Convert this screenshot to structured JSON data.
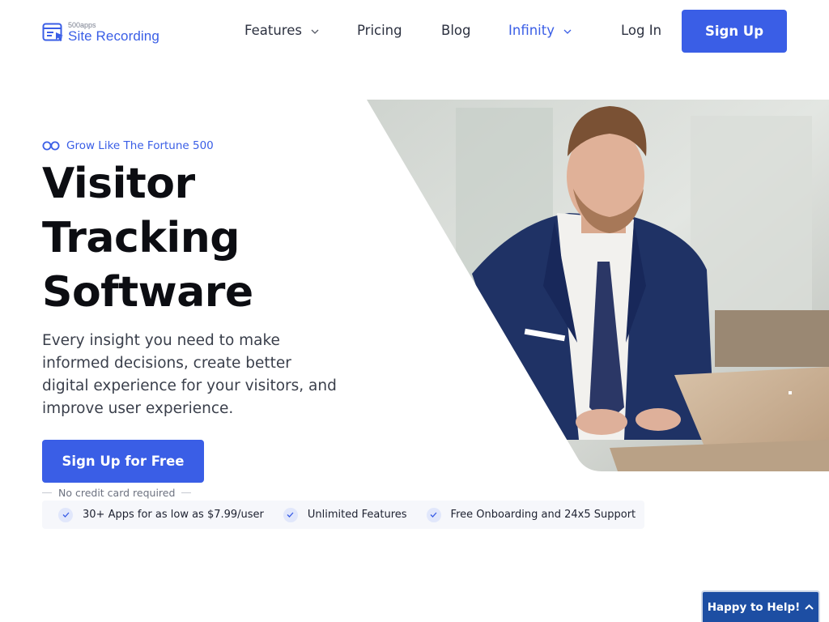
{
  "header": {
    "logo_small": "500apps",
    "logo_main": "Site Recording",
    "nav": [
      {
        "label": "Features",
        "dropdown": true
      },
      {
        "label": "Pricing",
        "dropdown": false
      },
      {
        "label": "Blog",
        "dropdown": false
      },
      {
        "label": "Infinity",
        "dropdown": true
      }
    ],
    "login_label": "Log In",
    "signup_label": "Sign Up"
  },
  "hero": {
    "eyebrow": "Grow Like The Fortune 500",
    "title_lines": [
      "Visitor",
      "Tracking",
      "Software"
    ],
    "description": "Every insight you need to make informed decisions, create better digital experience for your visitors, and improve user experience.",
    "cta_label": "Sign Up for Free",
    "no_credit_card": "No credit card required",
    "features": [
      "30+ Apps for as low as $7.99/user",
      "Unlimited Features",
      "Free Onboarding and 24x5 Support"
    ]
  },
  "help_widget": {
    "label": "Happy to Help!"
  },
  "colors": {
    "accent": "#3a5ee6",
    "title": "#0c0d12",
    "help_bg": "#1d4ea3"
  }
}
